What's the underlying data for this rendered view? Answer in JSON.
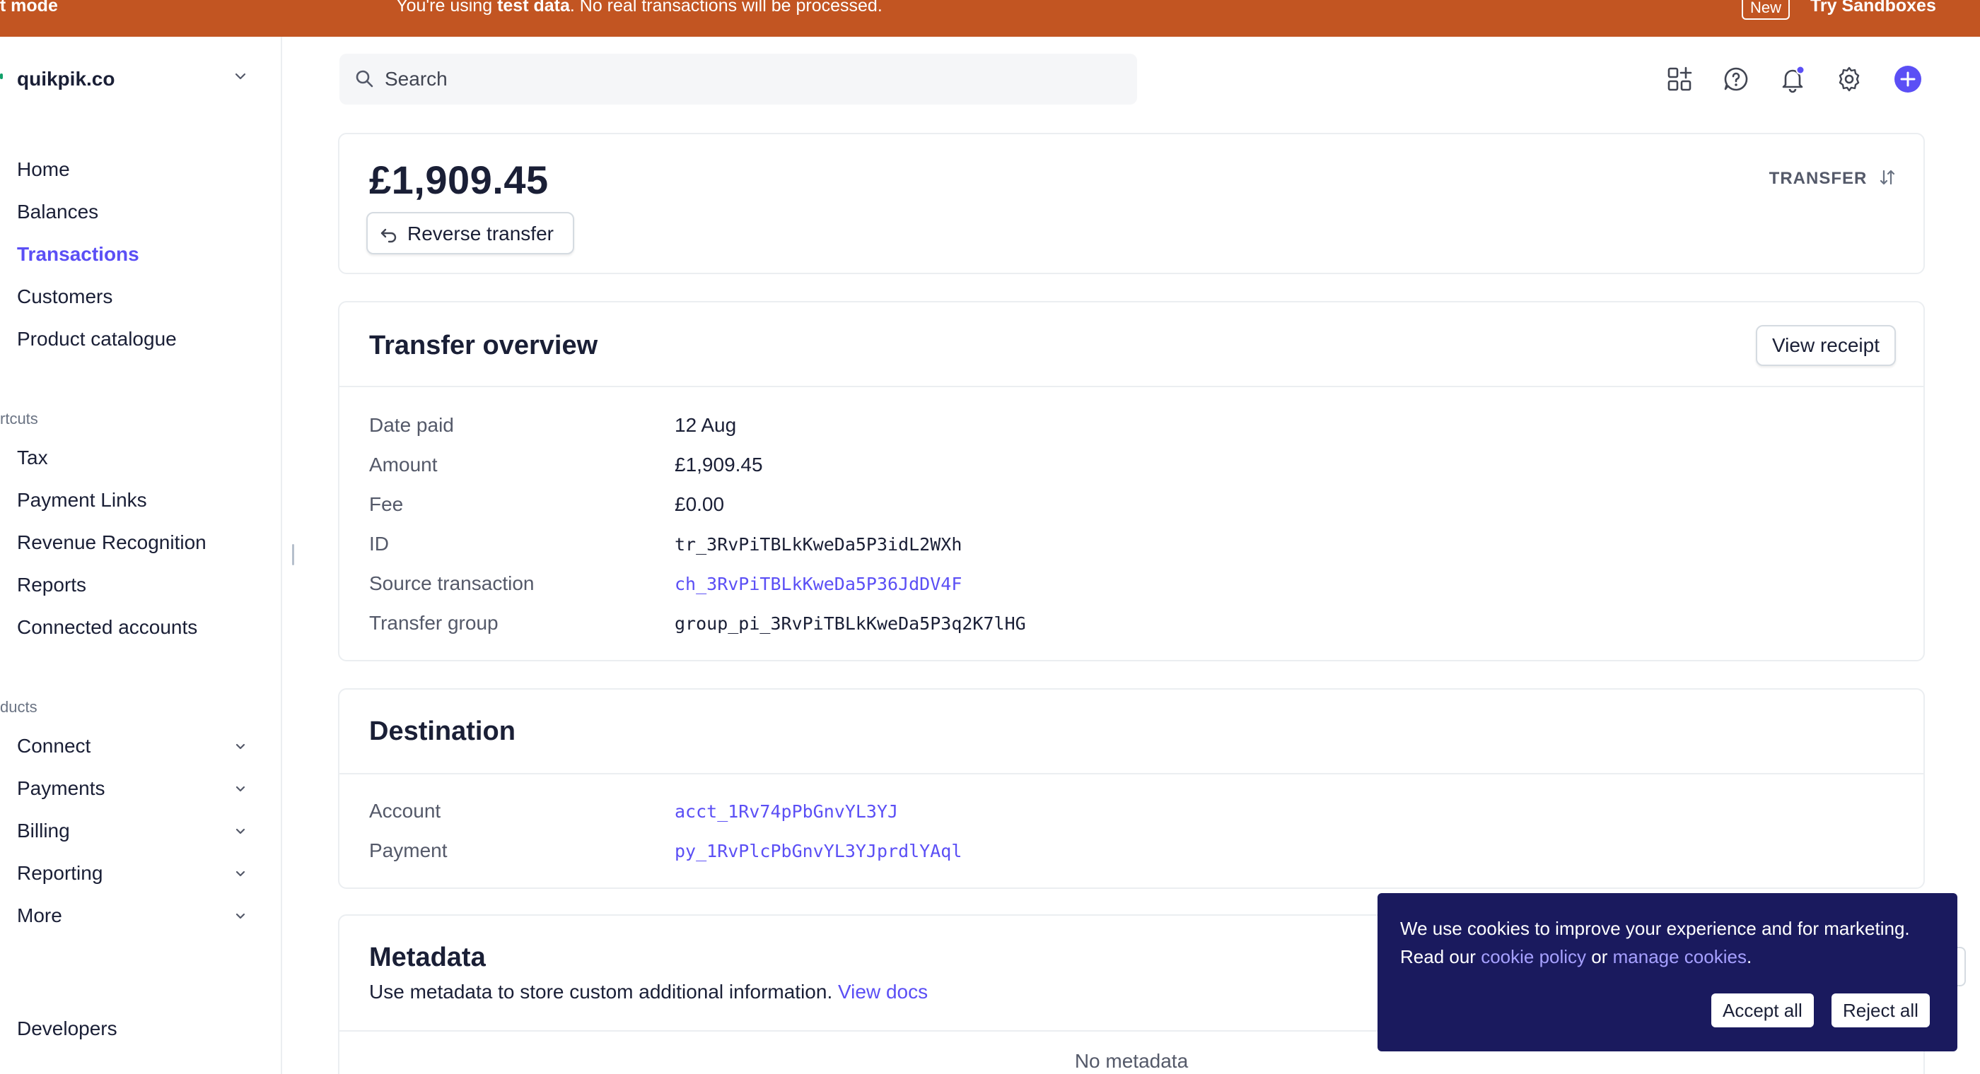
{
  "banner": {
    "mode_label": "st mode",
    "message_prefix": "You're using ",
    "message_bold": "test data",
    "message_suffix": ". No real transactions will be processed.",
    "new_badge": "New",
    "sandbox_link": "Try Sandboxes",
    "color": "#c25522"
  },
  "sidebar": {
    "account_name": "quikpik.co",
    "main_items": [
      {
        "label": "Home"
      },
      {
        "label": "Balances"
      },
      {
        "label": "Transactions",
        "active": true
      },
      {
        "label": "Customers"
      },
      {
        "label": "Product catalogue"
      }
    ],
    "shortcuts_heading": "rtcuts",
    "shortcut_items": [
      {
        "label": "Tax"
      },
      {
        "label": "Payment Links"
      },
      {
        "label": "Revenue Recognition"
      },
      {
        "label": "Reports"
      },
      {
        "label": "Connected accounts"
      }
    ],
    "products_heading": "ducts",
    "product_items": [
      {
        "label": "Connect"
      },
      {
        "label": "Payments"
      },
      {
        "label": "Billing"
      },
      {
        "label": "Reporting"
      },
      {
        "label": "More"
      }
    ],
    "developers_label": "Developers"
  },
  "topbar": {
    "search_placeholder": "Search",
    "icons": [
      "apps-icon",
      "help-icon",
      "bell-icon",
      "gear-icon",
      "plus-circle-icon"
    ],
    "accent": "#5b4ff5"
  },
  "summary": {
    "amount": "£1,909.45",
    "reverse_button": "Reverse transfer",
    "type_label": "TRANSFER"
  },
  "overview": {
    "title": "Transfer overview",
    "view_receipt": "View receipt",
    "rows": [
      {
        "label": "Date paid",
        "value": "12 Aug"
      },
      {
        "label": "Amount",
        "value": "£1,909.45"
      },
      {
        "label": "Fee",
        "value": "£0.00"
      },
      {
        "label": "ID",
        "value": "tr_3RvPiTBLkKweDa5P3idL2WXh"
      },
      {
        "label": "Source transaction",
        "value": "ch_3RvPiTBLkKweDa5P36JdDV4F"
      },
      {
        "label": "Transfer group",
        "value": "group_pi_3RvPiTBLkKweDa5P3q2K7lHG"
      }
    ]
  },
  "destination": {
    "title": "Destination",
    "rows": [
      {
        "label": "Account",
        "value": "acct_1Rv74pPbGnvYL3YJ"
      },
      {
        "label": "Payment",
        "value": "py_1RvPlcPbGnvYL3YJprdlYAql"
      }
    ]
  },
  "metadata": {
    "title": "Metadata",
    "description": "Use metadata to store custom additional information.",
    "docs_link": "View docs",
    "empty_text": "No metadata"
  },
  "cookie": {
    "text_prefix": "We use cookies to improve your experience and for marketing. Read our ",
    "policy_link": "cookie policy",
    "text_middle": " or ",
    "manage_link": "manage cookies",
    "text_suffix": ".",
    "accept": "Accept all",
    "reject": "Reject all",
    "background": "#1a1a5e"
  }
}
